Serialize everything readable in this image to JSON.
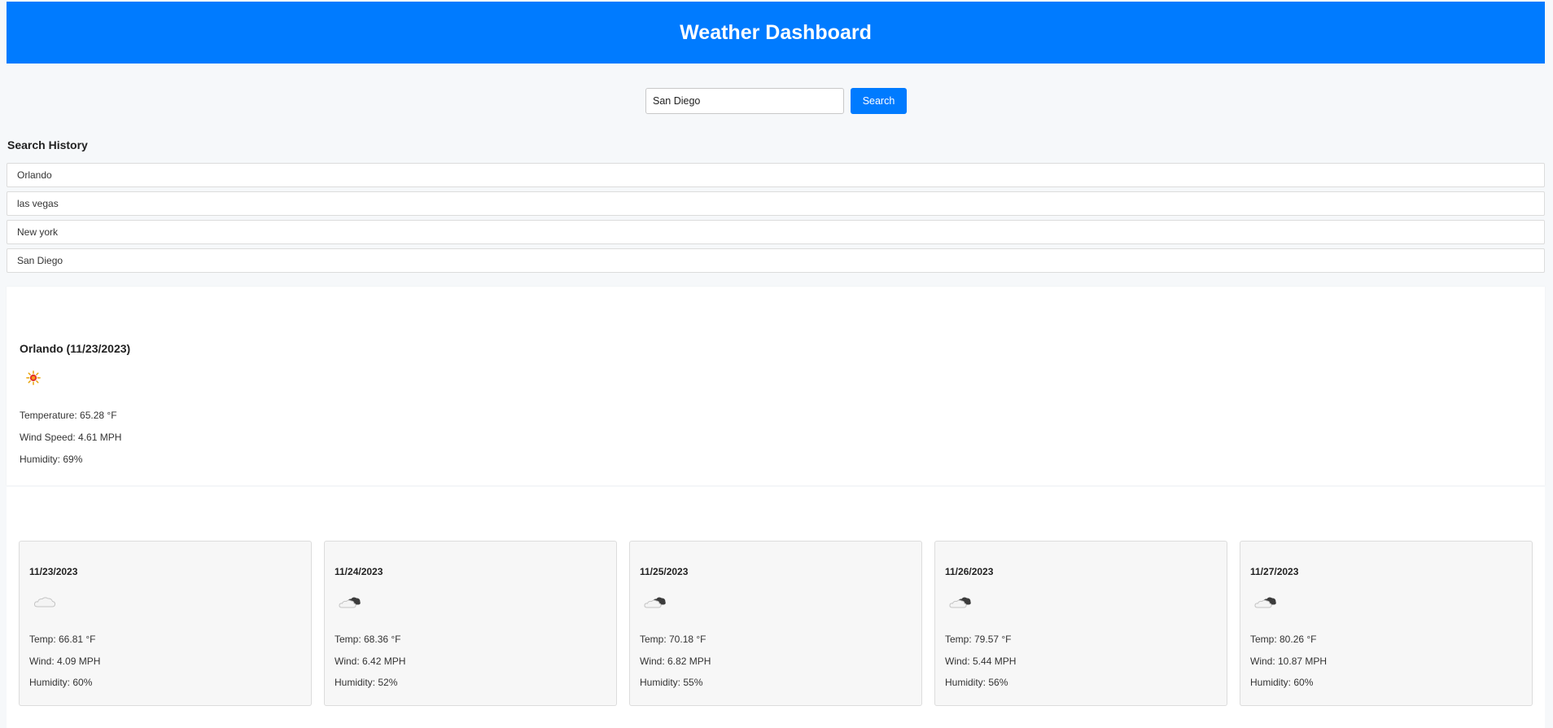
{
  "header": {
    "title": "Weather Dashboard"
  },
  "search": {
    "value": "San Diego",
    "button_label": "Search"
  },
  "history": {
    "heading": "Search History",
    "items": [
      {
        "label": "Orlando"
      },
      {
        "label": "las vegas"
      },
      {
        "label": "New york"
      },
      {
        "label": "San Diego"
      }
    ]
  },
  "current": {
    "title": "Orlando (11/23/2023)",
    "icon": "sun-icon",
    "temperature": "Temperature: 65.28 °F",
    "wind": "Wind Speed: 4.61 MPH",
    "humidity": "Humidity: 69%"
  },
  "forecast": [
    {
      "date": "11/23/2023",
      "icon": "cloud-icon",
      "temp": "Temp: 66.81 °F",
      "wind": "Wind: 4.09 MPH",
      "humidity": "Humidity: 60%"
    },
    {
      "date": "11/24/2023",
      "icon": "broken-clouds-icon",
      "temp": "Temp: 68.36 °F",
      "wind": "Wind: 6.42 MPH",
      "humidity": "Humidity: 52%"
    },
    {
      "date": "11/25/2023",
      "icon": "broken-clouds-icon",
      "temp": "Temp: 70.18 °F",
      "wind": "Wind: 6.82 MPH",
      "humidity": "Humidity: 55%"
    },
    {
      "date": "11/26/2023",
      "icon": "broken-clouds-icon",
      "temp": "Temp: 79.57 °F",
      "wind": "Wind: 5.44 MPH",
      "humidity": "Humidity: 56%"
    },
    {
      "date": "11/27/2023",
      "icon": "broken-clouds-icon",
      "temp": "Temp: 80.26 °F",
      "wind": "Wind: 10.87 MPH",
      "humidity": "Humidity: 60%"
    }
  ],
  "colors": {
    "accent": "#007bff",
    "page_background": "#f6f8fa",
    "card_background": "#f7f7f7"
  }
}
